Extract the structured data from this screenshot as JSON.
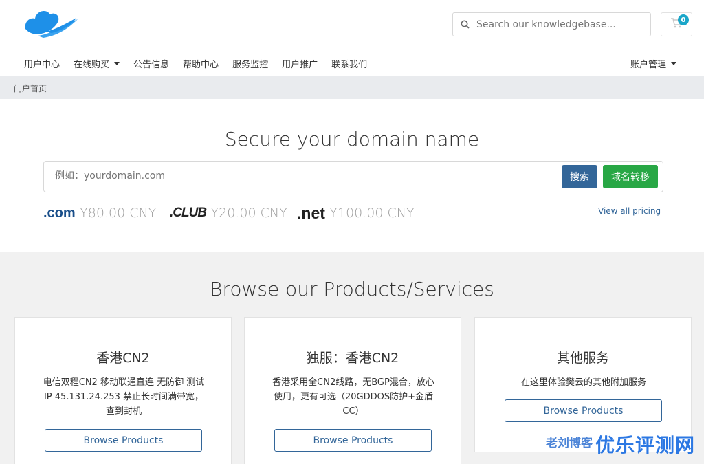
{
  "header": {
    "logo_icon": "cloud-logo-icon",
    "search": {
      "placeholder": "Search our knowledgebase...",
      "icon": "search-icon"
    },
    "cart": {
      "icon": "cart-icon",
      "count": "0"
    }
  },
  "nav": {
    "items": [
      {
        "label": "用户中心"
      },
      {
        "label": "在线购买",
        "dropdown": true
      },
      {
        "label": "公告信息"
      },
      {
        "label": "帮助中心"
      },
      {
        "label": "服务监控"
      },
      {
        "label": "用户推广"
      },
      {
        "label": "联系我们"
      }
    ],
    "account": {
      "label": "账户管理",
      "dropdown": true
    }
  },
  "breadcrumb": {
    "current": "门户首页"
  },
  "domain": {
    "title": "Secure your domain name",
    "input_placeholder": "例如：yourdomain.com",
    "search_label": "搜索",
    "transfer_label": "域名转移",
    "tlds": [
      {
        "logo": ".com",
        "price": "¥80.00 CNY"
      },
      {
        "logo": ".CLUB",
        "price": "¥20.00 CNY"
      },
      {
        "logo": ".net",
        "price": "¥100.00 CNY"
      }
    ],
    "view_all": "View all pricing"
  },
  "products": {
    "title": "Browse our Products/Services",
    "cards": [
      {
        "name": "香港CN2",
        "description": "电信双程CN2 移动联通直连 无防御 测试IP 45.131.24.253 禁止长时间满带宽，查到封机",
        "button": "Browse Products"
      },
      {
        "name": "独服：香港CN2",
        "description": "香港采用全CN2线路，无BGP混合，放心使用，更有可选（20GDDOS防护+金盾CC）",
        "button": "Browse Products"
      },
      {
        "name": "其他服务",
        "description": "在这里体验樊云的其他附加服务",
        "button": "Browse Products"
      }
    ]
  },
  "watermark": {
    "small": "老刘博客",
    "big": "优乐评测网"
  },
  "colors": {
    "primary": "#336699",
    "success": "#28a745",
    "badge": "#1aa6c9",
    "logo": "#1e90e8"
  }
}
